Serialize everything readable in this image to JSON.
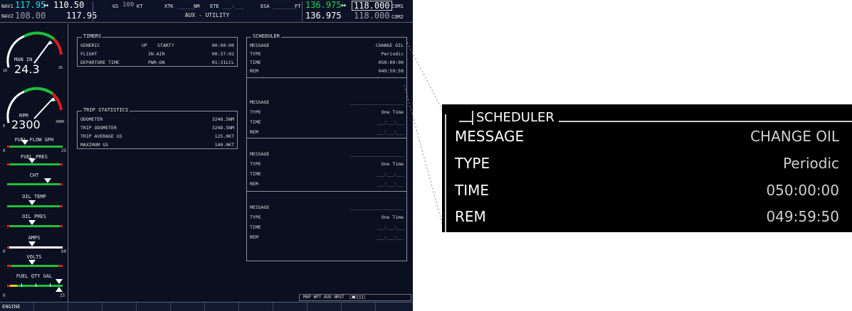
{
  "topbar": {
    "nav1_label": "NAV1",
    "nav1_active": "117.95",
    "nav1_arrow": "↔",
    "nav1_standby": "110.50",
    "nav2_label": "NAV2",
    "nav2_active": "108.00",
    "nav2_standby": "117.95",
    "gs_label": "GS",
    "gs_value": "100",
    "gs_unit": "KT",
    "xtk_label": "XTK",
    "xtk_value": "______",
    "xtk_unit": "NM",
    "ete_label": "ETE",
    "ete_value": "___:___",
    "esa_label": "ESA",
    "esa_value": "________",
    "esa_unit": "FT",
    "com1_active": "136.975",
    "com1_arrow": "↔",
    "com1_standby": "118.000",
    "com1_label": "COM1",
    "com2_active": "136.975",
    "com2_standby": "118.000",
    "com2_label": "COM2",
    "page_title": "AUX - UTILITY"
  },
  "engine": {
    "man_in_label": "MAN IN",
    "man_in_value": "24.3",
    "man_scale_min": "10",
    "man_scale_max": "35",
    "rpm_label": "RPM",
    "rpm_value": "2300",
    "rpm_scale_min": "0",
    "rpm_scale_max": "3000",
    "fuel_flow_label": "FUEL FLOW GPH",
    "fuel_flow_min": "0",
    "fuel_flow_max": "25",
    "fuel_pres_label": "FUEL PRES",
    "cht_label": "CHT",
    "oil_temp_label": "OIL TEMP",
    "oil_pres_label": "OIL PRES",
    "amps_label": "AMPS",
    "amps_min": "0",
    "amps_max": "60",
    "volts_label": "VOLTS",
    "fuel_qty_label": "FUEL QTY GAL",
    "fuel_qty_min": "0",
    "fuel_qty_max": "25"
  },
  "timers": {
    "title": "TIMERS",
    "rows": [
      {
        "name": "GENERIC",
        "mode": "UP",
        "action": "START?",
        "value": "00:00:00"
      },
      {
        "name": "FLIGHT",
        "mode": "IN-AIR",
        "action": "",
        "value": "00:37:02"
      },
      {
        "name": "DEPARTURE TIME",
        "mode": "PWR-ON",
        "action": "",
        "value": "01:31LCL"
      }
    ]
  },
  "trip_statistics": {
    "title": "TRIP STATISTICS",
    "rows": [
      {
        "name": "ODOMETER",
        "value": "3248.5NM"
      },
      {
        "name": "TRIP ODOMETER",
        "value": "3248.5NM"
      },
      {
        "name": "TRIP AVERAGE GS",
        "value": "125.0KT"
      },
      {
        "name": "MAXIMUM GS",
        "value": "140.0KT"
      }
    ]
  },
  "scheduler": {
    "title": "SCHEDULER",
    "groups": [
      {
        "message_label": "MESSAGE",
        "message": "CHANGE OIL",
        "type_label": "TYPE",
        "type": "Periodic",
        "time_label": "TIME",
        "time": "050:00:00",
        "rem_label": "REM",
        "rem": "049:59:50"
      },
      {
        "message_label": "MESSAGE",
        "message": "______________________",
        "type_label": "TYPE",
        "type": "One Time",
        "time_label": "TIME",
        "time": "___:___:___",
        "rem_label": "REM",
        "rem": "___:___:___"
      },
      {
        "message_label": "MESSAGE",
        "message": "______________________",
        "type_label": "TYPE",
        "type": "One Time",
        "time_label": "TIME",
        "time": "___:___:___",
        "rem_label": "REM",
        "rem": "___:___:___"
      },
      {
        "message_label": "MESSAGE",
        "message": "______________________",
        "type_label": "TYPE",
        "type": "One Time",
        "time_label": "TIME",
        "time": "___:___:___",
        "rem_label": "REM",
        "rem": "___:___:___"
      }
    ]
  },
  "page_group": {
    "label": "MAP WPT AUX NRST",
    "indicator": "□■□□□□"
  },
  "softkeys": {
    "first": "ENGINE"
  },
  "zoom": {
    "title": "SCHEDULER",
    "rows": [
      {
        "label": "MESSAGE",
        "value": "CHANGE OIL"
      },
      {
        "label": "TYPE",
        "value": "Periodic"
      },
      {
        "label": "TIME",
        "value": "050:00:00"
      },
      {
        "label": "REM",
        "value": "049:59:50"
      }
    ]
  },
  "colors": {
    "screen_bg": "#0a1020",
    "cyan": "#16e6e6",
    "green": "#1fbf3a",
    "red": "#d62020",
    "yellow": "#e0d020",
    "inset_bg": "#000000"
  }
}
